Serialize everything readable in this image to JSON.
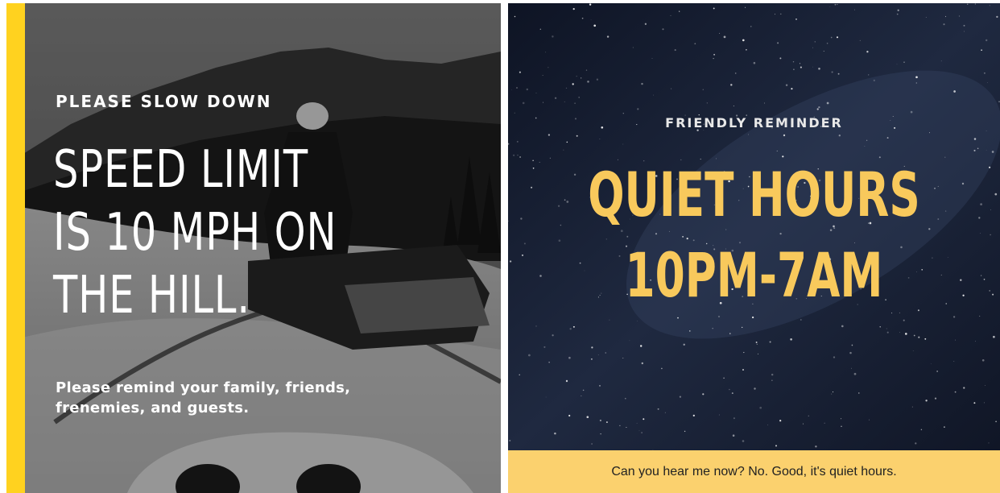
{
  "left_card": {
    "kicker": "PLEASE SLOW DOWN",
    "headline_lines": [
      "SPEED LIMIT",
      "IS 10 MPH ON",
      "THE HILL."
    ],
    "subtext_line1": "Please remind your family, friends,",
    "subtext_line2": "frenemies, and guests.",
    "accent_color": "#ffd21f",
    "photo_subject": "snowmobile-rider-on-mountain-trail"
  },
  "right_card": {
    "kicker": "FRIENDLY REMINDER",
    "headline_lines": [
      "QUIET HOURS",
      "10PM-7AM"
    ],
    "footer": "Can you hear me now? No. Good, it's quiet hours.",
    "headline_color": "#f8c95c",
    "footer_color": "#fbd16e",
    "background": "starry-night-sky"
  }
}
